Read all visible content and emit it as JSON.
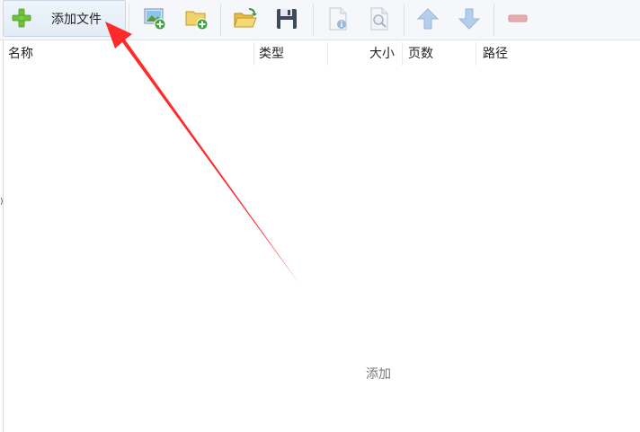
{
  "toolbar": {
    "add_file_label": "添加文件",
    "buttons": [
      {
        "name": "add-image",
        "icon": "image-add-icon"
      },
      {
        "name": "add-folder",
        "icon": "folder-add-icon"
      },
      {
        "name": "open",
        "icon": "folder-open-icon"
      },
      {
        "name": "save",
        "icon": "floppy-save-icon"
      },
      {
        "name": "file-info",
        "icon": "file-info-icon"
      },
      {
        "name": "file-preview",
        "icon": "file-search-icon"
      },
      {
        "name": "move-up",
        "icon": "arrow-up-icon"
      },
      {
        "name": "move-down",
        "icon": "arrow-down-icon"
      },
      {
        "name": "remove",
        "icon": "minus-icon"
      }
    ]
  },
  "table": {
    "columns": [
      "名称",
      "类型",
      "大小",
      "页数",
      "路径"
    ]
  },
  "list": {
    "empty_hint": "添加",
    "edge_mark": ")"
  },
  "colors": {
    "annotation_arrow": "#ff2a2a",
    "plus_green": "#6ec23a",
    "toolbar_bg": "#f5f7fa"
  }
}
